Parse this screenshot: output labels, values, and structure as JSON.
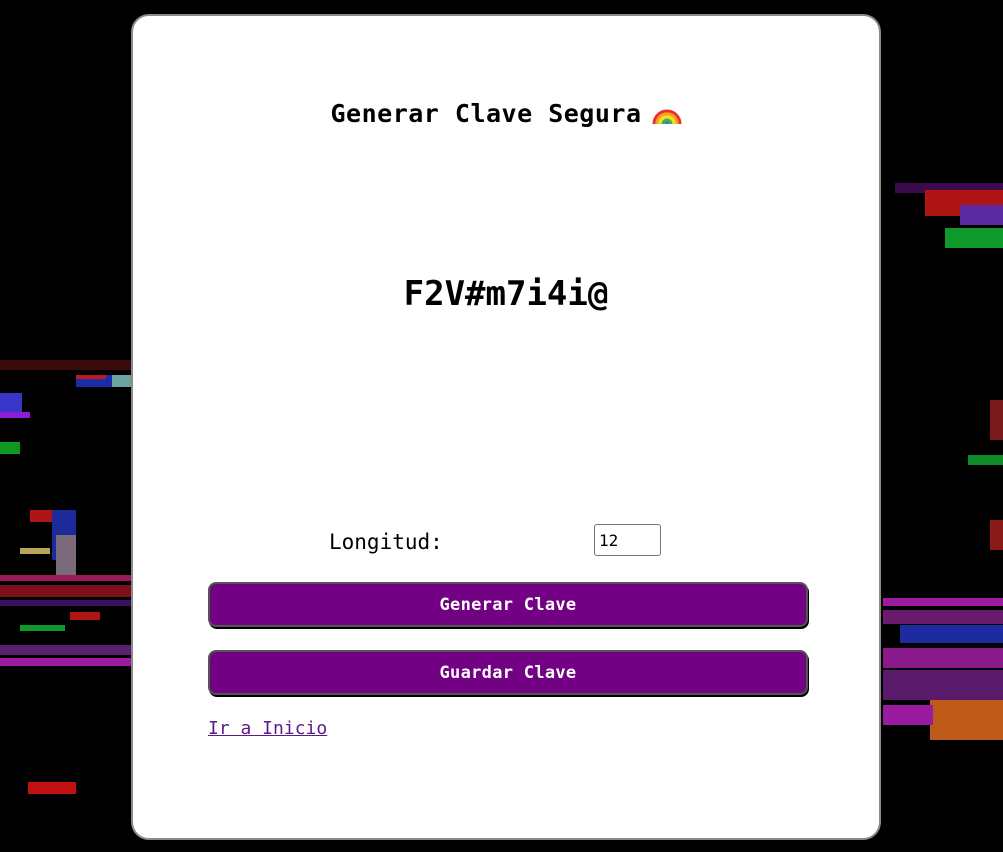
{
  "page": {
    "title": "Generar Clave Segura",
    "title_icon": "rainbow-icon",
    "accent_color": "#720283"
  },
  "password": {
    "value": "F2V#m7i4i@"
  },
  "length": {
    "label": "Longitud:",
    "value": "12"
  },
  "buttons": {
    "generate_label": "Generar Clave",
    "save_label": "Guardar Clave"
  },
  "links": {
    "home_label": "Ir a Inicio"
  }
}
